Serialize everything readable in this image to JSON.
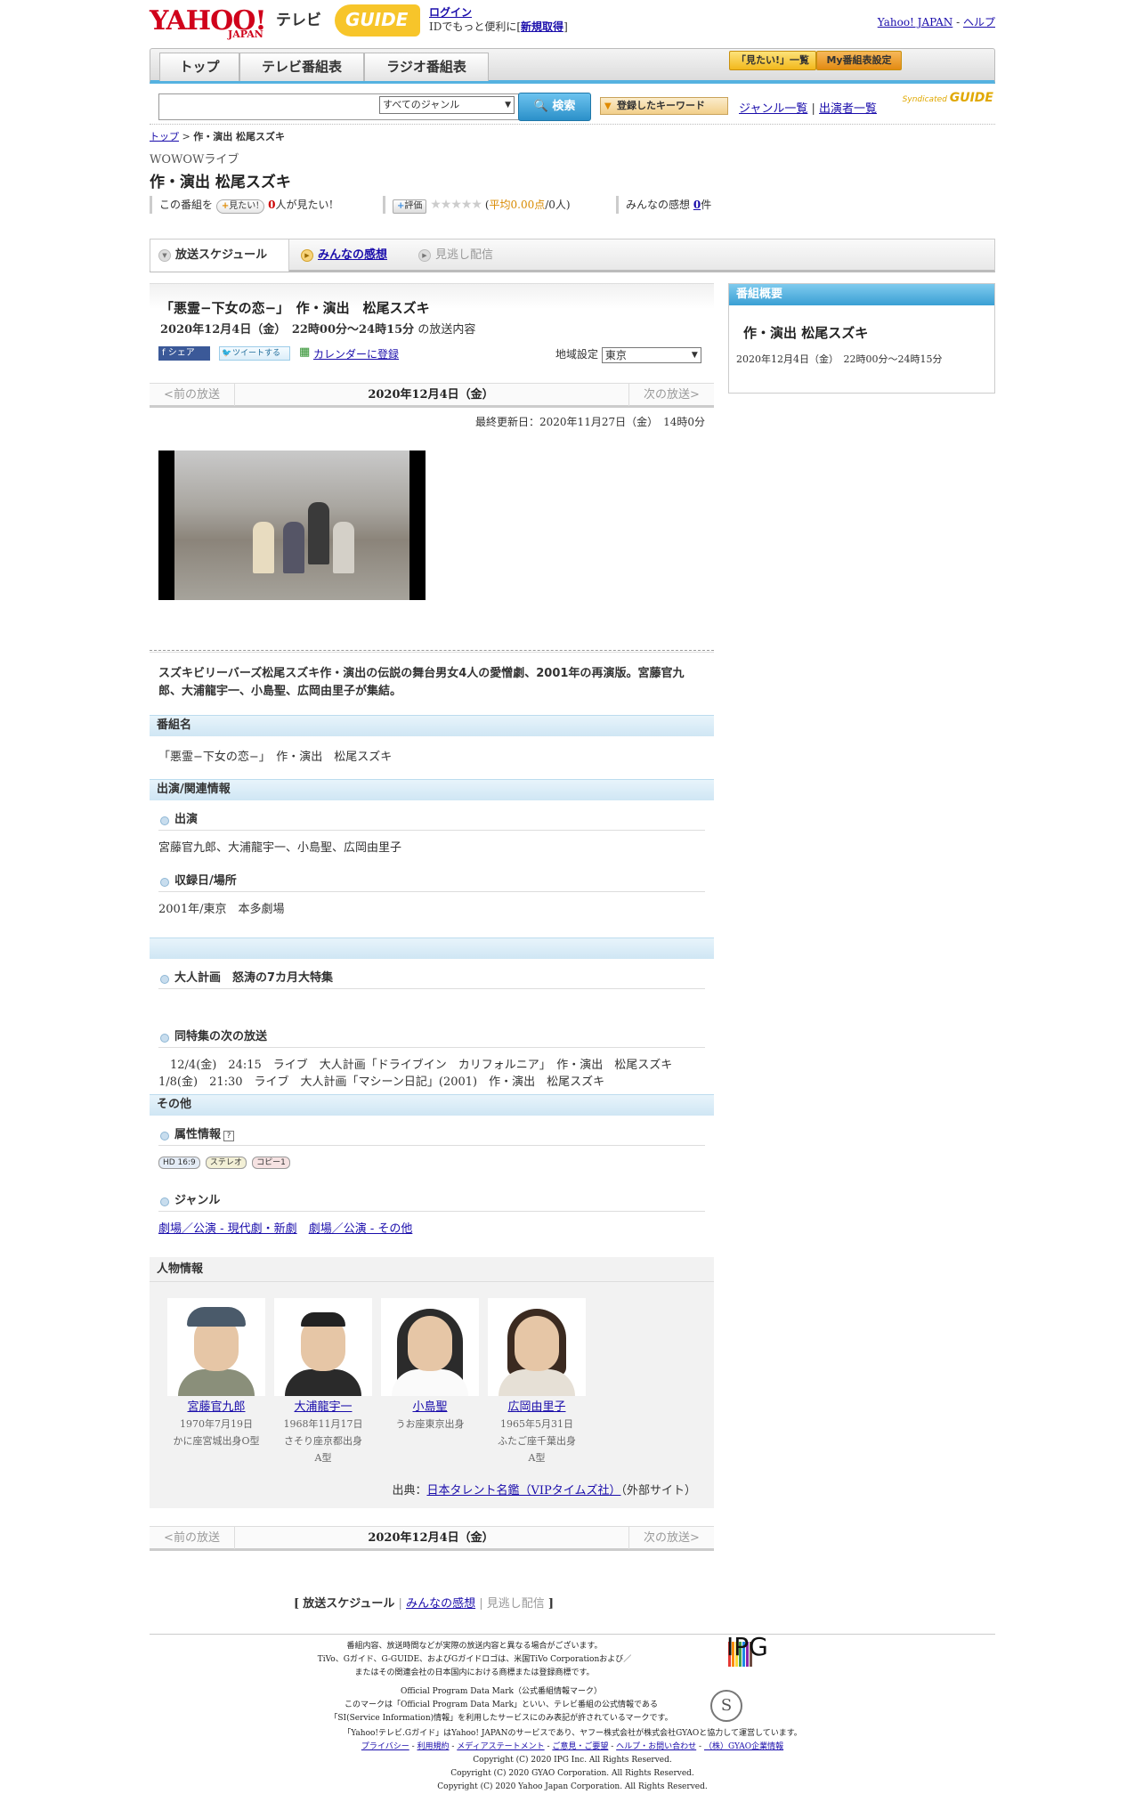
{
  "header": {
    "logo_yahoo": "YAHOO!",
    "logo_japan": "JAPAN",
    "logo_tv": "テレビ",
    "logo_gguide": "GUIDE",
    "login": "ログイン",
    "login_note": "IDでもっと便利に[",
    "signup": "新規取得",
    "login_note_end": "]",
    "yahoo_japan_link": "Yahoo! JAPAN",
    "help_link": "ヘルプ"
  },
  "nav": {
    "tabs": [
      "トップ",
      "テレビ番組表",
      "ラジオ番組表"
    ],
    "mitai_list": "「見たい!」一覧",
    "my_bangumi": "My番組表設定"
  },
  "search": {
    "input_value": "",
    "genre_selected": "すべてのジャンル",
    "search_button": "検索",
    "keyword_button": "登録したキーワード",
    "genre_list": "ジャンル一覧",
    "performer_list": "出演者一覧",
    "syndicated": "Syndicated",
    "syndicated_logo": "GUIDE"
  },
  "breadcrumb": {
    "top": "トップ",
    "current": "作・演出 松尾スズキ"
  },
  "program": {
    "channel": "WOWOWライブ",
    "title": "作・演出 松尾スズキ",
    "mitai_prefix": "この番組を",
    "mitai_button": "見たい!",
    "mitai_count": "0",
    "mitai_suffix": "人が見たい!",
    "rating_button": "評価",
    "stars": "★★★★★",
    "avg_open": "(",
    "avg": "平均0.00点",
    "avg_count": "/0人)",
    "impressions_label": "みんなの感想",
    "impressions_count": "0",
    "impressions_unit": "件"
  },
  "subtabs": [
    "放送スケジュール",
    "みんなの感想",
    "見逃し配信"
  ],
  "broadcast": {
    "full_title": "「悪霊−下女の恋−」　作・演出　松尾スズキ",
    "date_time": "2020年12月4日（金）　22時00分～24時15分",
    "date_suffix": "の放送内容",
    "share": "シェア",
    "tweet": "ツイートする",
    "calendar": "カレンダーに登録",
    "region_label": "地域設定",
    "region_value": "東京",
    "pager_prev": "<前の放送",
    "pager_current": "2020年12月4日（金）",
    "pager_next": "次の放送>",
    "updated": "最終更新日：2020年11月27日（金）　14時0分",
    "description": "スズキビリーバーズ松尾スズキ作・演出の伝説の舞台男女4人の愛憎劇、2001年の再演版。宮藤官九郎、大浦龍宇一、小島聖、広岡由里子が集結。"
  },
  "sections": {
    "program_name_header": "番組名",
    "program_name": "「悪霊−下女の恋−」　作・演出　松尾スズキ",
    "cast_header": "出演/関連情報",
    "cast_sub": "出演",
    "cast": "宮藤官九郎、大浦龍宇一、小島聖、広岡由里子",
    "record_sub": "収録日/場所",
    "record": "2001年/東京　本多劇場",
    "special_sub": "大人計画　怒涛の7カ月大特集",
    "next_sub": "同特集の次の放送",
    "next_lines": "　12/4(金)　24:15　ライブ　大人計画「ドライブイン　カリフォルニア」　作・演出　松尾スズキ　1/8(金)　21:30　ライブ　大人計画「マシーン日記」(2001)　作・演出　松尾スズキ",
    "other_header": "その他",
    "attr_sub": "属性情報",
    "attr_help": "?",
    "badges": [
      "HD 16:9",
      "ステレオ",
      "コピー1"
    ],
    "genre_sub": "ジャンル",
    "genre1": "劇場／公演 - 現代劇・新劇",
    "genre2": "劇場／公演 - その他"
  },
  "people": {
    "header": "人物情報",
    "list": [
      {
        "name": "宮藤官九郎",
        "birth": "1970年7月19日",
        "info": "かに座宮城出身O型",
        "info2": ""
      },
      {
        "name": "大浦龍宇一",
        "birth": "1968年11月17日",
        "info": "さそり座京都出身",
        "info2": "A型"
      },
      {
        "name": "小島聖",
        "birth": "うお座東京出身",
        "info": "",
        "info2": ""
      },
      {
        "name": "広岡由里子",
        "birth": "1965年5月31日",
        "info": "ふたご座千葉出身",
        "info2": "A型"
      }
    ],
    "source_prefix": "出典：",
    "source_link": "日本タレント名鑑（VIPタイムズ社）",
    "source_suffix": "（外部サイト）"
  },
  "bottom_tabs": {
    "open": "[",
    "schedule": "放送スケジュール",
    "sep1": "|",
    "impressions": "みんなの感想",
    "sep2": "|",
    "missed": "見逃し配信",
    "close": "]"
  },
  "sidebar": {
    "header": "番組概要",
    "title": "作・演出 松尾スズキ",
    "date": "2020年12月4日（金）　22時00分～24時15分"
  },
  "footer": {
    "l1": "番組内容、放送時間などが実際の放送内容と異なる場合がございます。",
    "l2": "TiVo、Gガイド、G-GUIDE、およびGガイドロゴは、米国TiVo Corporationおよび／",
    "l3": "またはその関連会社の日本国内における商標または登録商標です。",
    "ipg": "IPG",
    "l4": "Official Program Data Mark（公式番組情報マーク）",
    "l5": "このマークは「Official Program Data Mark」といい、テレビ番組の公式情報である",
    "l6": "「SI(Service Information)情報」を利用したサービスにのみ表記が許されているマークです。",
    "smark": "S",
    "l7": "「Yahoo!テレビ.Gガイド」はYahoo! JAPANのサービスであり、ヤフー株式会社が株式会社GYAOと協力して運営しています。",
    "links": [
      "プライバシー",
      "利用規約",
      "メディアステートメント",
      "ご意見・ご要望",
      "ヘルプ・お問い合わせ",
      "（株）GYAO企業情報"
    ],
    "c1": "Copyright (C) 2020 IPG Inc. All Rights Reserved.",
    "c2": "Copyright (C) 2020 GYAO Corporation. All Rights Reserved.",
    "c3": "Copyright (C) 2020 Yahoo Japan Corporation. All Rights Reserved."
  }
}
